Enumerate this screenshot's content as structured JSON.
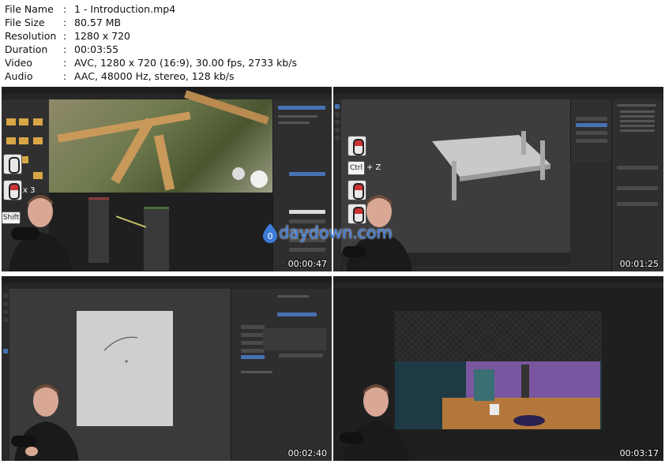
{
  "file_info": {
    "rows": [
      {
        "label": "File Name",
        "value": "1 - Introduction.mp4"
      },
      {
        "label": "File Size",
        "value": "80.57 MB"
      },
      {
        "label": "Resolution",
        "value": "1280 x 720"
      },
      {
        "label": "Duration",
        "value": "00:03:55"
      },
      {
        "label": "Video",
        "value": "AVC, 1280 x 720 (16:9), 30.00 fps, 2733 kb/s"
      },
      {
        "label": "Audio",
        "value": "AAC, 48000 Hz, stereo, 128 kb/s"
      }
    ]
  },
  "thumbnails": [
    {
      "timestamp": "00:00:47"
    },
    {
      "timestamp": "00:01:25"
    },
    {
      "timestamp": "00:02:40"
    },
    {
      "timestamp": "00:03:17"
    }
  ],
  "watermark": {
    "text": "daydown.com",
    "color": "#3d7bd9"
  },
  "overlay_keys": {
    "ctrl": "Ctrl",
    "z": "+ Z",
    "shift": "Shift",
    "x3": "x 3"
  },
  "colors": {
    "blender_bg": "#2b2b2b",
    "highlight": "#4772b3"
  }
}
